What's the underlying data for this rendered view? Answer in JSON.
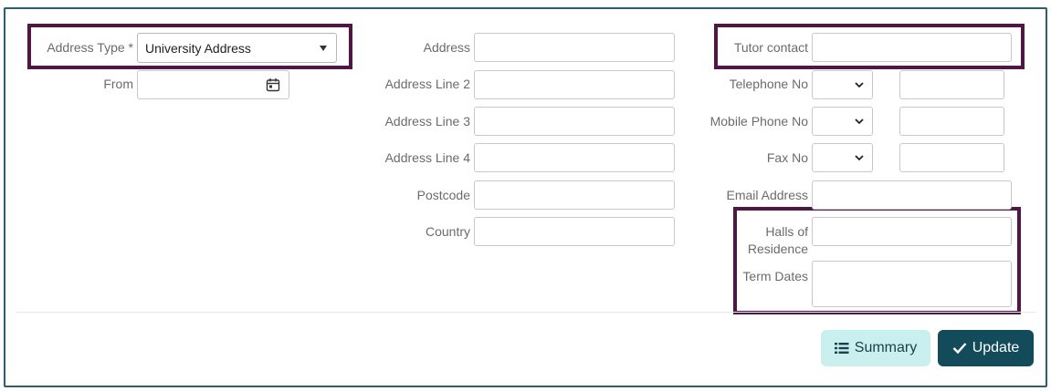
{
  "form": {
    "address_type": {
      "label": "Address Type *",
      "value": "University Address"
    },
    "from": {
      "label": "From",
      "value": ""
    },
    "address": {
      "label": "Address",
      "value": ""
    },
    "address_line_2": {
      "label": "Address Line 2",
      "value": ""
    },
    "address_line_3": {
      "label": "Address Line 3",
      "value": ""
    },
    "address_line_4": {
      "label": "Address Line 4",
      "value": ""
    },
    "postcode": {
      "label": "Postcode",
      "value": ""
    },
    "country": {
      "label": "Country",
      "value": ""
    },
    "tutor_contact": {
      "label": "Tutor contact",
      "value": ""
    },
    "telephone_no": {
      "label": "Telephone No",
      "value": ""
    },
    "mobile_phone_no": {
      "label": "Mobile Phone No",
      "value": ""
    },
    "fax_no": {
      "label": "Fax No",
      "value": ""
    },
    "email_address": {
      "label": "Email Address",
      "value": ""
    },
    "halls_of_residence": {
      "label_line1": "Halls of",
      "label_line2": "Residence",
      "value": ""
    },
    "term_dates": {
      "label": "Term Dates",
      "value": ""
    }
  },
  "buttons": {
    "summary": "Summary",
    "update": "Update"
  },
  "icons": {
    "calendar": "calendar-icon",
    "chevron": "chevron-down-icon",
    "list": "list-icon",
    "check": "checkmark-icon"
  },
  "colors": {
    "highlight": "#4e1846",
    "frame": "#2e5d6b",
    "summary_bg": "#c9f0ee",
    "update_bg": "#134b5b"
  }
}
